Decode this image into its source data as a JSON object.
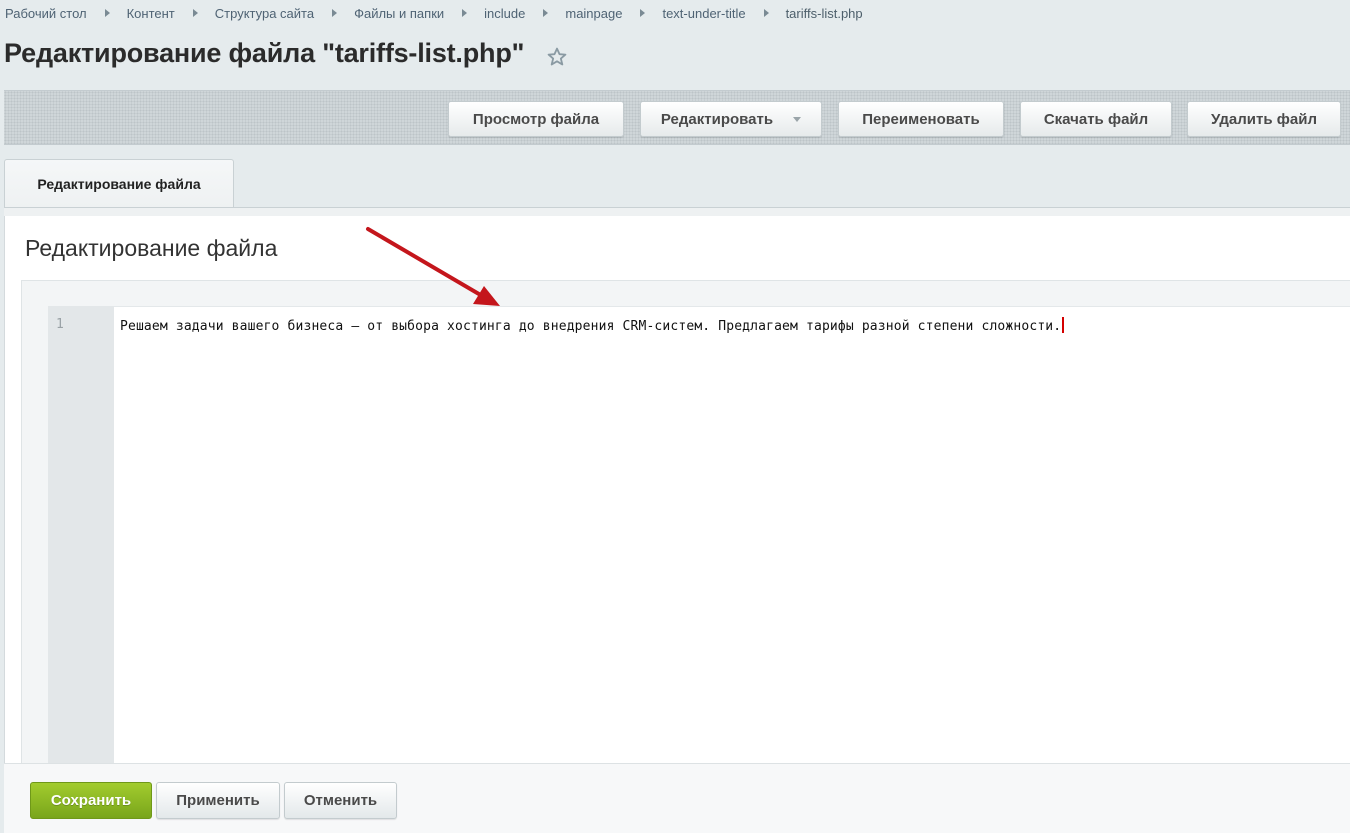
{
  "breadcrumbs": [
    {
      "label": "Рабочий стол"
    },
    {
      "label": "Контент"
    },
    {
      "label": "Структура сайта"
    },
    {
      "label": "Файлы и папки"
    },
    {
      "label": "include"
    },
    {
      "label": "mainpage"
    },
    {
      "label": "text-under-title"
    },
    {
      "label": "tariffs-list.php"
    }
  ],
  "page": {
    "title": "Редактирование файла \"tariffs-list.php\"",
    "favorite_icon": "star-outline-icon"
  },
  "toolbar": {
    "view_file": "Просмотр файла",
    "edit": "Редактировать",
    "rename": "Переименовать",
    "download": "Скачать файл",
    "delete": "Удалить файл"
  },
  "tabs": [
    {
      "label": "Редактирование файла",
      "active": true
    }
  ],
  "section": {
    "title": "Редактирование файла"
  },
  "editor": {
    "lines": [
      {
        "number": "1",
        "text": "Решаем задачи вашего бизнеса — от выбора хостинга до внедрения CRM-систем. Предлагаем тарифы разной степени сложности."
      }
    ]
  },
  "annotation": {
    "arrow_color": "#c4161c"
  },
  "footer": {
    "save": "Сохранить",
    "apply": "Применить",
    "cancel": "Отменить"
  },
  "colors": {
    "primary_button": "#8bbb22",
    "caret": "#d40000"
  }
}
